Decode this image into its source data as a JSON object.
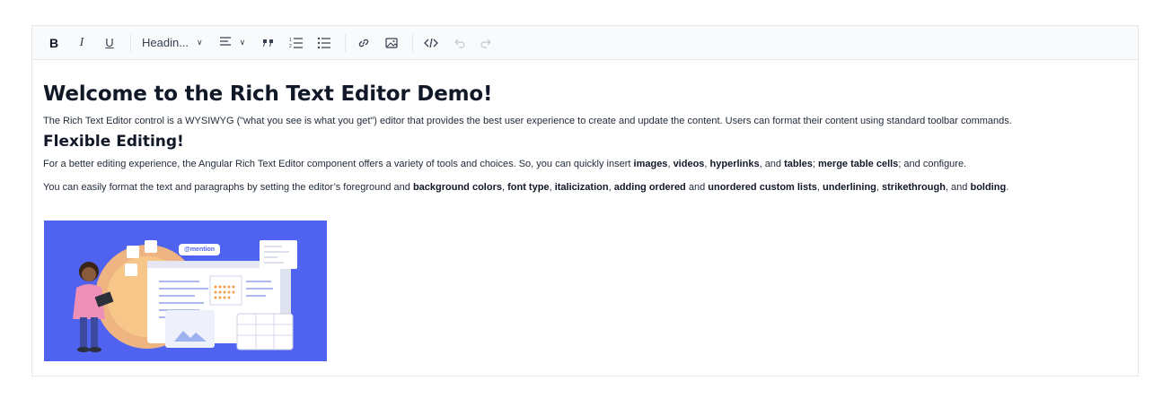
{
  "toolbar": {
    "bold": "B",
    "italic": "I",
    "underline": "U",
    "format_dropdown": "Headin...",
    "items": [
      {
        "icon": "bold-icon"
      },
      {
        "icon": "italic-icon"
      },
      {
        "icon": "underline-icon"
      },
      {
        "icon": "format-dropdown"
      },
      {
        "icon": "align-dropdown"
      },
      {
        "icon": "blockquote-icon"
      },
      {
        "icon": "ordered-list-icon"
      },
      {
        "icon": "unordered-list-icon"
      },
      {
        "icon": "link-icon"
      },
      {
        "icon": "image-icon"
      },
      {
        "icon": "source-code-icon"
      },
      {
        "icon": "undo-icon"
      },
      {
        "icon": "redo-icon"
      }
    ]
  },
  "content": {
    "title": "Welcome to the Rich Text Editor Demo!",
    "intro": "The Rich Text Editor control is a WYSIWYG (\"what you see is what you get\") editor that provides the best user experience to create and update the content. Users can format their content using standard toolbar commands.",
    "subtitle": "Flexible Editing!",
    "p2": {
      "a": "For a better editing experience, the Angular Rich Text Editor component offers a variety of tools and choices. So, you can quickly insert ",
      "images": "images",
      "s1": ", ",
      "videos": "videos",
      "s2": ", ",
      "hyperlinks": "hyperlinks",
      "s3": ", and ",
      "tables": "tables",
      "s4": "; ",
      "merge": "merge table cells",
      "s5": "; and configure."
    },
    "p3": {
      "a": "You can easily format the text and paragraphs by setting the editor’s foreground and ",
      "bg": "background colors",
      "s1": ", ",
      "font": "font type",
      "s2": ", ",
      "ital": "italicization",
      "s3": ", ",
      "ordered": "adding ordered",
      "s4": " and ",
      "unordered": "unordered custom lists",
      "s5": ", ",
      "under": "underlining",
      "s6": ", ",
      "strike": "strikethrough",
      "s7": ", and ",
      "bolding": "bolding",
      "s8": "."
    },
    "image": {
      "mention_label": "@mention"
    }
  },
  "colors": {
    "hero_bg": "#4f63f0",
    "toolbar_bg": "#f9fafb",
    "border": "#e5e7eb"
  }
}
